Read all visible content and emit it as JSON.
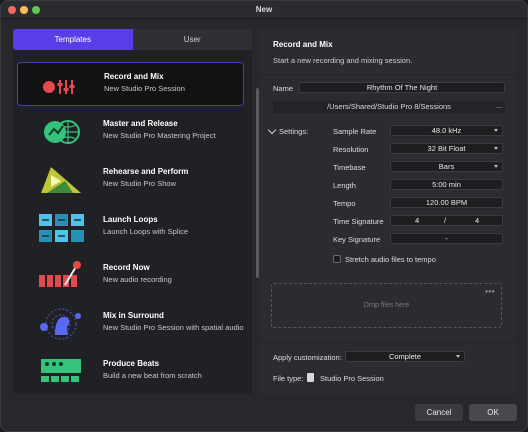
{
  "window": {
    "title": "New"
  },
  "tabs": [
    {
      "label": "Templates",
      "active": true
    },
    {
      "label": "User",
      "active": false
    }
  ],
  "templates": [
    {
      "title": "Record and Mix",
      "subtitle": "New Studio Pro Session",
      "icon": "record-mix-icon",
      "selected": true
    },
    {
      "title": "Master and Release",
      "subtitle": "New Studio Pro Mastering Project",
      "icon": "master-release-icon",
      "selected": false
    },
    {
      "title": "Rehearse and Perform",
      "subtitle": "New Studio Pro Show",
      "icon": "rehearse-perform-icon",
      "selected": false
    },
    {
      "title": "Launch Loops",
      "subtitle": "Launch Loops with Splice",
      "icon": "launch-loops-icon",
      "selected": false
    },
    {
      "title": "Record Now",
      "subtitle": "New audio recording",
      "icon": "record-now-icon",
      "selected": false
    },
    {
      "title": "Mix in Surround",
      "subtitle": "New Studio Pro Session with spatial audio",
      "icon": "surround-icon",
      "selected": false
    },
    {
      "title": "Produce Beats",
      "subtitle": "Build a new beat from scratch",
      "icon": "beats-icon",
      "selected": false
    }
  ],
  "details": {
    "title": "Record and Mix",
    "description": "Start a new recording and mixing session.",
    "name_label": "Name",
    "name_value": "Rhythm Of The Night",
    "path": "/Users/Shared/Studio Pro 8/Sessions",
    "path_more": "...",
    "settings_label": "Settings:",
    "settings": {
      "sample_rate": {
        "label": "Sample Rate",
        "value": "48.0 kHz"
      },
      "resolution": {
        "label": "Resolution",
        "value": "32 Bit Float"
      },
      "timebase": {
        "label": "Timebase",
        "value": "Bars"
      },
      "length": {
        "label": "Length",
        "value": "5:00 min"
      },
      "tempo": {
        "label": "Tempo",
        "value": "120.00 BPM"
      },
      "time_signature": {
        "label": "Time Signature",
        "numerator": "4",
        "separator": "/",
        "denominator": "4"
      },
      "key_signature": {
        "label": "Key Signature",
        "value": "-"
      }
    },
    "stretch_label": "Stretch audio files to tempo",
    "stretch_checked": false,
    "drop_text": "Drop files here",
    "drop_more": "•••",
    "apply_label": "Apply customization:",
    "apply_value": "Complete",
    "filetype_label": "File type:",
    "filetype_value": "Studio Pro Session"
  },
  "buttons": {
    "cancel": "Cancel",
    "ok": "OK"
  },
  "colors": {
    "accent": "#5a3de6",
    "record_red": "#e5484d",
    "loop_cyan": "#4fc4e8",
    "master_green": "#35c27a",
    "perform_yellow": "#d9e03a"
  }
}
